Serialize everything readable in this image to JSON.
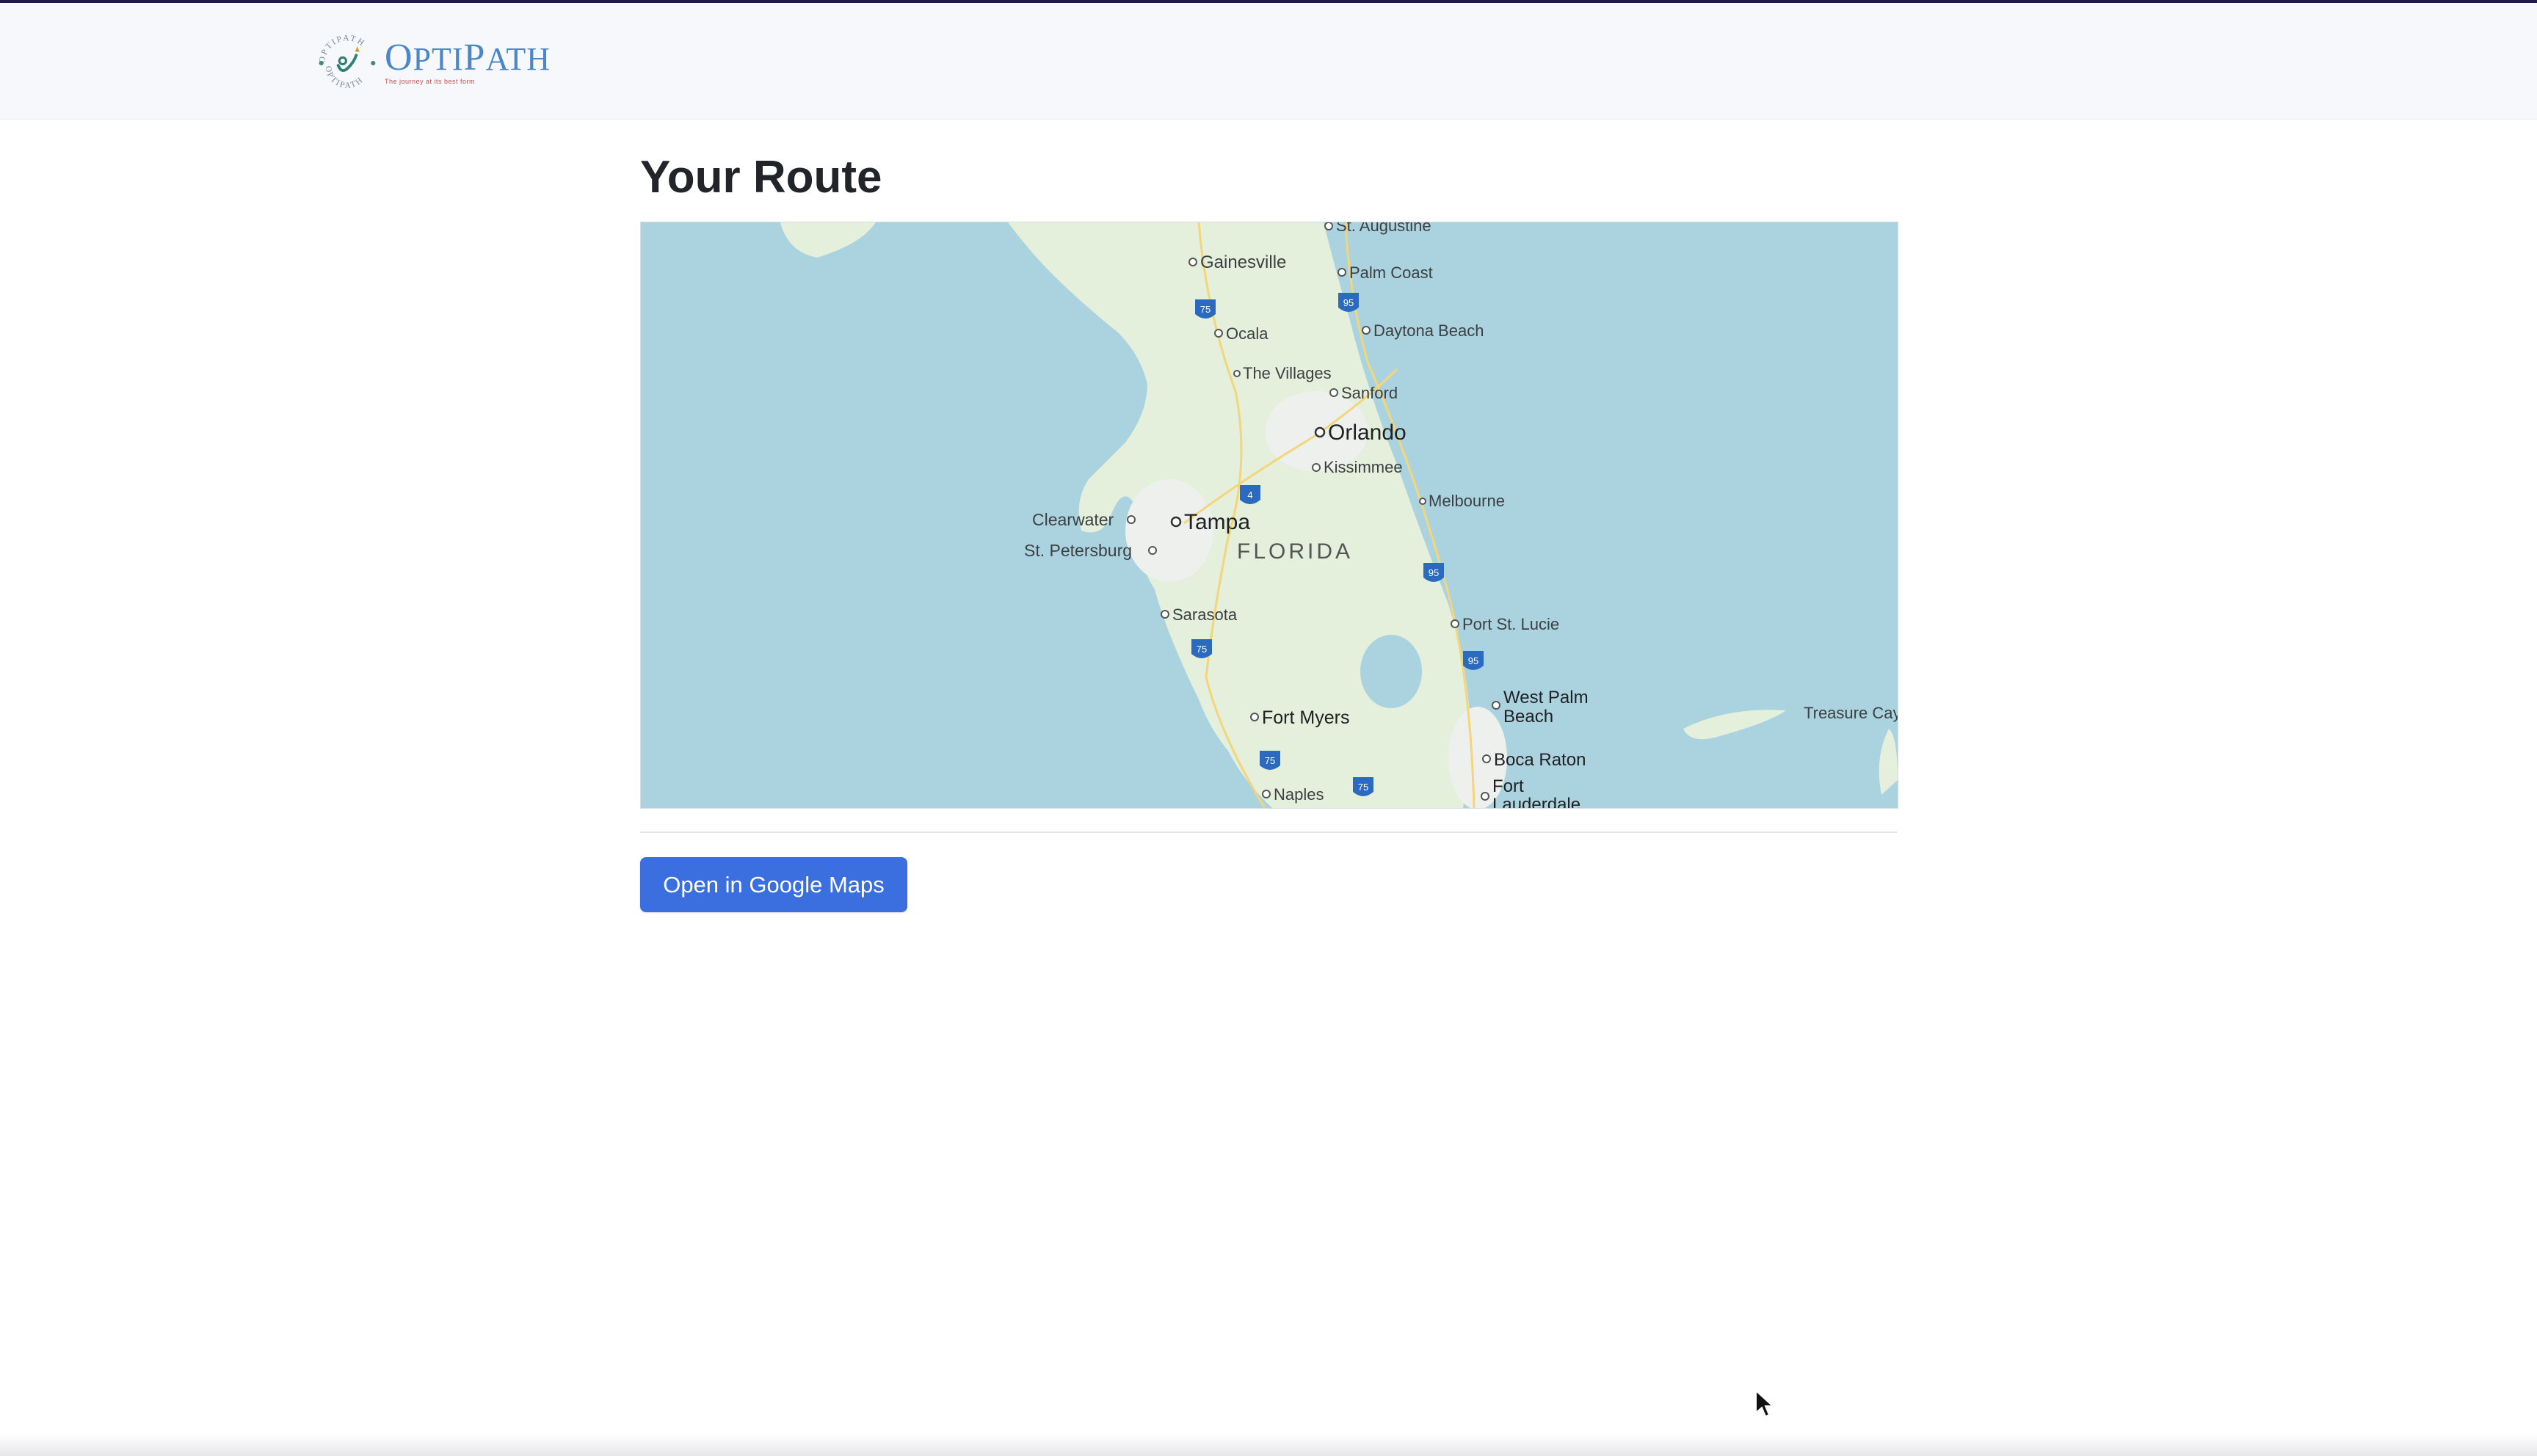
{
  "app": {
    "logo_name_first": "O",
    "logo_name_rest": "PTI",
    "logo_name_second": "P",
    "logo_name_second_rest": "ATH",
    "logo_ring_text": "OPTIPATH",
    "logo_tagline": "The journey at its best form"
  },
  "page": {
    "title": "Your Route"
  },
  "map": {
    "cities": {
      "st_augustine": "St. Augustine",
      "gainesville": "Gainesville",
      "palm_coast": "Palm Coast",
      "ocala": "Ocala",
      "daytona": "Daytona Beach",
      "villages": "The Villages",
      "sanford": "Sanford",
      "orlando": "Orlando",
      "kissimmee": "Kissimmee",
      "melbourne": "Melbourne",
      "clearwater": "Clearwater",
      "tampa": "Tampa",
      "st_petersburg": "St. Petersburg",
      "florida": "FLORIDA",
      "sarasota": "Sarasota",
      "port_st_lucie": "Port St. Lucie",
      "west_palm_1": "West Palm",
      "west_palm_2": "Beach",
      "treasure_cay": "Treasure Cay",
      "fort_myers": "Fort Myers",
      "boca_raton": "Boca Raton",
      "fort_laud_1": "Fort",
      "fort_laud_2": "Lauderdale",
      "naples": "Naples"
    },
    "shields": {
      "i75": "75",
      "i95": "95",
      "i4": "4"
    },
    "colors": {
      "water": "#aad3df",
      "land": "#e4efdc",
      "urban": "#eef0ee"
    }
  },
  "actions": {
    "open_google_maps": "Open in Google Maps"
  }
}
